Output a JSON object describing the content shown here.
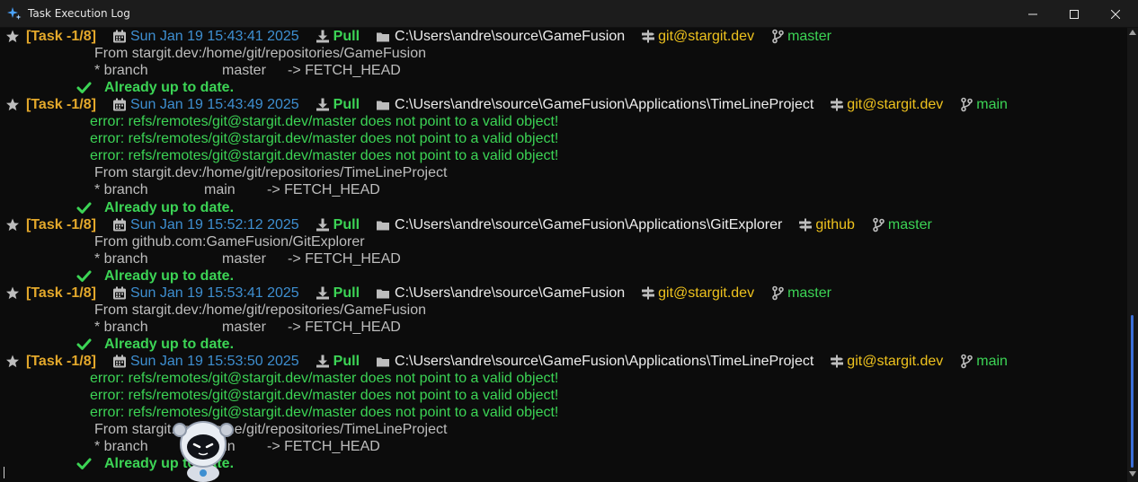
{
  "window": {
    "title": "Task Execution Log",
    "controls": [
      "minimize",
      "maximize",
      "close"
    ]
  },
  "colors": {
    "background": "#0c0c0c",
    "task_label": "#e3a82b",
    "date": "#3e8fd1",
    "success": "#3cd455",
    "remote": "#eec21e",
    "path": "#ededed",
    "output": "#bdbdbd",
    "scroll_thumb": "#3b6fd8"
  },
  "icons": {
    "task": "star-icon",
    "date": "calendar-icon",
    "action": "download-icon",
    "path": "folder-icon",
    "remote": "signpost-icon",
    "branch": "git-branch-icon",
    "success": "check-icon"
  },
  "entries": [
    {
      "task": "[Task -1/8]",
      "date": "Sun Jan 19 15:43:41 2025",
      "action": "Pull",
      "path": "C:\\Users\\andre\\source\\GameFusion",
      "remote": "git@stargit.dev",
      "branch": "master",
      "output": [
        {
          "kind": "plain",
          "text": "From stargit.dev:/home/git/repositories/GameFusion"
        },
        {
          "kind": "ref",
          "star": "* branch",
          "name": "master",
          "target": "-> FETCH_HEAD"
        },
        {
          "kind": "ok",
          "text": "Already up to date."
        }
      ]
    },
    {
      "task": "[Task -1/8]",
      "date": "Sun Jan 19 15:43:49 2025",
      "action": "Pull",
      "path": "C:\\Users\\andre\\source\\GameFusion\\Applications\\TimeLineProject",
      "remote": "git@stargit.dev",
      "branch": "main",
      "output": [
        {
          "kind": "err",
          "text": "error: refs/remotes/git@stargit.dev/master does not point to a valid object!"
        },
        {
          "kind": "err",
          "text": "error: refs/remotes/git@stargit.dev/master does not point to a valid object!"
        },
        {
          "kind": "err",
          "text": "error: refs/remotes/git@stargit.dev/master does not point to a valid object!"
        },
        {
          "kind": "plain",
          "text": "From stargit.dev:/home/git/repositories/TimeLineProject"
        },
        {
          "kind": "ref",
          "star": "* branch",
          "name": "main",
          "target": "-> FETCH_HEAD"
        },
        {
          "kind": "ok",
          "text": "Already up to date."
        }
      ]
    },
    {
      "task": "[Task -1/8]",
      "date": "Sun Jan 19 15:52:12 2025",
      "action": "Pull",
      "path": "C:\\Users\\andre\\source\\GameFusion\\Applications\\GitExplorer",
      "remote": "github",
      "branch": "master",
      "output": [
        {
          "kind": "plain",
          "text": "From github.com:GameFusion/GitExplorer"
        },
        {
          "kind": "ref",
          "star": "* branch",
          "name": "master",
          "target": "-> FETCH_HEAD"
        },
        {
          "kind": "ok",
          "text": "Already up to date."
        }
      ]
    },
    {
      "task": "[Task -1/8]",
      "date": "Sun Jan 19 15:53:41 2025",
      "action": "Pull",
      "path": "C:\\Users\\andre\\source\\GameFusion",
      "remote": "git@stargit.dev",
      "branch": "master",
      "output": [
        {
          "kind": "plain",
          "text": "From stargit.dev:/home/git/repositories/GameFusion"
        },
        {
          "kind": "ref",
          "star": "* branch",
          "name": "master",
          "target": "-> FETCH_HEAD"
        },
        {
          "kind": "ok",
          "text": "Already up to date."
        }
      ]
    },
    {
      "task": "[Task -1/8]",
      "date": "Sun Jan 19 15:53:50 2025",
      "action": "Pull",
      "path": "C:\\Users\\andre\\source\\GameFusion\\Applications\\TimeLineProject",
      "remote": "git@stargit.dev",
      "branch": "main",
      "output": [
        {
          "kind": "err",
          "text": "error: refs/remotes/git@stargit.dev/master does not point to a valid object!"
        },
        {
          "kind": "err",
          "text": "error: refs/remotes/git@stargit.dev/master does not point to a valid object!"
        },
        {
          "kind": "err",
          "text": "error: refs/remotes/git@stargit.dev/master does not point to a valid object!"
        },
        {
          "kind": "plain",
          "text": "From stargit.dev:/home/git/repositories/TimeLineProject"
        },
        {
          "kind": "ref",
          "star": "* branch",
          "name": "main",
          "target": "-> FETCH_HEAD"
        },
        {
          "kind": "ok",
          "text": "Already up to date."
        }
      ]
    }
  ]
}
